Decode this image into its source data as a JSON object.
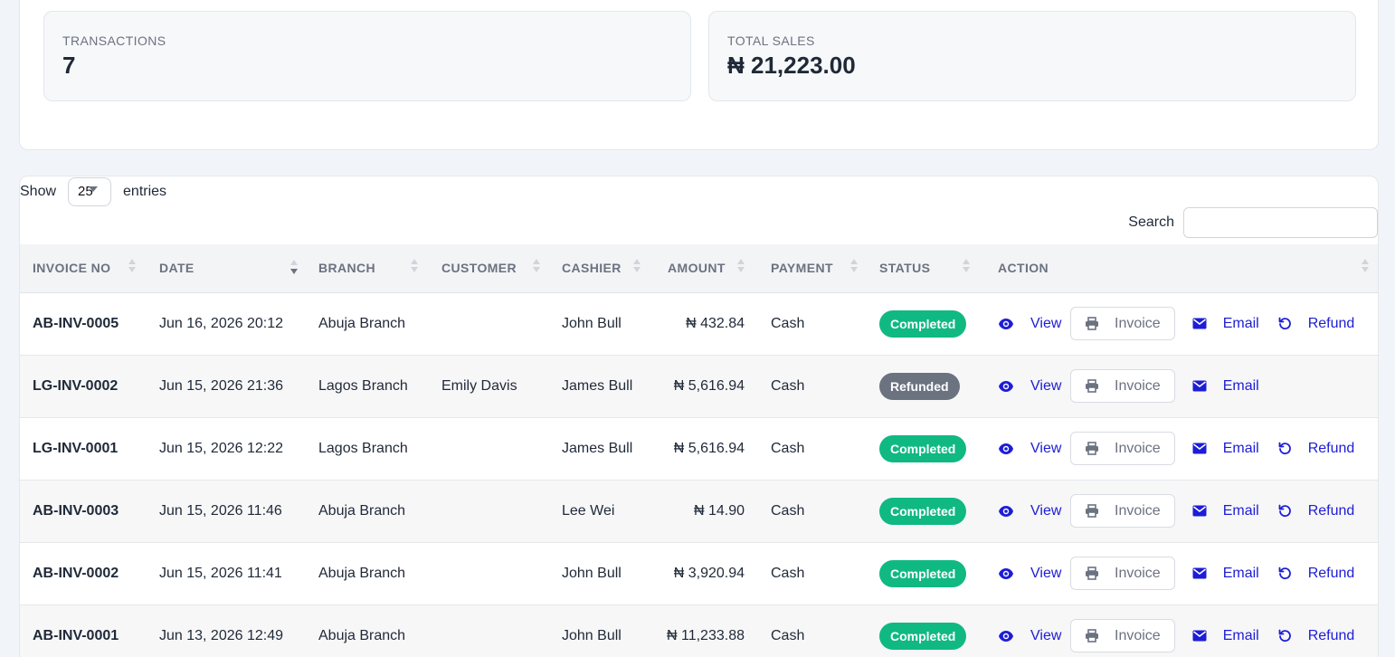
{
  "summary": {
    "transactions_label": "TRANSACTIONS",
    "transactions_value": "7",
    "total_sales_label": "TOTAL SALES",
    "total_sales_value": "₦ 21,223.00"
  },
  "controls": {
    "show_label": "Show",
    "entries_value": "25",
    "entries_label": "entries",
    "search_label": "Search",
    "search_value": ""
  },
  "columns": [
    "INVOICE NO",
    "DATE",
    "BRANCH",
    "CUSTOMER",
    "CASHIER",
    "AMOUNT",
    "PAYMENT",
    "STATUS",
    "ACTION"
  ],
  "sort_column": "DATE",
  "action_labels": {
    "view": "View",
    "invoice": "Invoice",
    "email": "Email",
    "refund": "Refund"
  },
  "rows": [
    {
      "invoice": "AB-INV-0005",
      "date": "Jun 16, 2026 20:12",
      "branch": "Abuja Branch",
      "customer": "",
      "cashier": "John Bull",
      "amount": "₦ 432.84",
      "payment": "Cash",
      "status": "Completed",
      "refundable": true
    },
    {
      "invoice": "LG-INV-0002",
      "date": "Jun 15, 2026 21:36",
      "branch": "Lagos Branch",
      "customer": "Emily Davis",
      "cashier": "James Bull",
      "amount": "₦ 5,616.94",
      "payment": "Cash",
      "status": "Refunded",
      "refundable": false
    },
    {
      "invoice": "LG-INV-0001",
      "date": "Jun 15, 2026 12:22",
      "branch": "Lagos Branch",
      "customer": "",
      "cashier": "James Bull",
      "amount": "₦ 5,616.94",
      "payment": "Cash",
      "status": "Completed",
      "refundable": true
    },
    {
      "invoice": "AB-INV-0003",
      "date": "Jun 15, 2026 11:46",
      "branch": "Abuja Branch",
      "customer": "",
      "cashier": "Lee Wei",
      "amount": "₦ 14.90",
      "payment": "Cash",
      "status": "Completed",
      "refundable": true
    },
    {
      "invoice": "AB-INV-0002",
      "date": "Jun 15, 2026 11:41",
      "branch": "Abuja Branch",
      "customer": "",
      "cashier": "John Bull",
      "amount": "₦ 3,920.94",
      "payment": "Cash",
      "status": "Completed",
      "refundable": true
    },
    {
      "invoice": "AB-INV-0001",
      "date": "Jun 13, 2026 12:49",
      "branch": "Abuja Branch",
      "customer": "",
      "cashier": "John Bull",
      "amount": "₦ 11,233.88",
      "payment": "Cash",
      "status": "Completed",
      "refundable": true
    }
  ],
  "colors": {
    "completed": "#10b981",
    "refunded": "#6b7280",
    "link": "#1d1dd6"
  }
}
